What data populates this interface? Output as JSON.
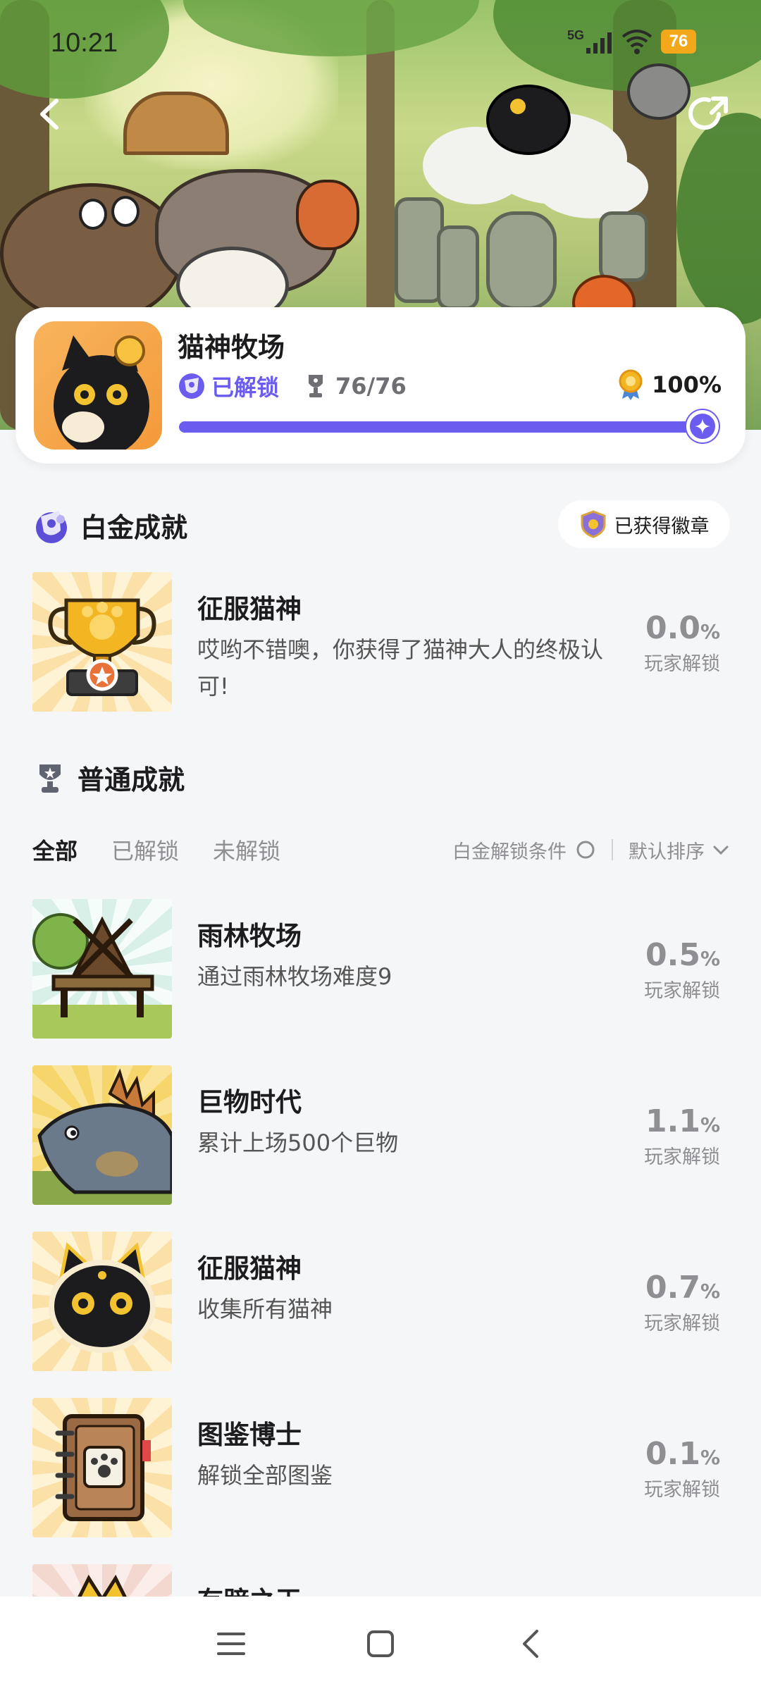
{
  "status_bar": {
    "time": "10:21",
    "network": "5G",
    "battery": "76"
  },
  "game": {
    "title": "猫神牧场",
    "unlock_label": "已解锁",
    "achievement_count": "76/76",
    "completion_percent": "100%",
    "completion_progress": 1.0,
    "accent_color": "#6b5cf0"
  },
  "platinum_section": {
    "title": "白金成就",
    "badge_button": "已获得徽章",
    "achievement": {
      "name": "征服猫神",
      "description": "哎哟不错噢，你获得了猫神大人的终极认可!",
      "percent_value": "0.0",
      "percent_sign": "%",
      "percent_label": "玩家解锁",
      "icon": "trophy-paw-icon"
    }
  },
  "normal_section": {
    "title": "普通成就",
    "tabs": [
      "全部",
      "已解锁",
      "未解锁"
    ],
    "platinum_condition": "白金解锁条件",
    "sort_label": "默认排序",
    "achievements": [
      {
        "name": "雨林牧场",
        "description": "通过雨林牧场难度9",
        "percent_value": "0.5",
        "percent_sign": "%",
        "percent_label": "玩家解锁",
        "icon": "windmill-icon"
      },
      {
        "name": "巨物时代",
        "description": "累计上场500个巨物",
        "percent_value": "1.1",
        "percent_sign": "%",
        "percent_label": "玩家解锁",
        "icon": "dinosaur-icon"
      },
      {
        "name": "征服猫神",
        "description": "收集所有猫神",
        "percent_value": "0.7",
        "percent_sign": "%",
        "percent_label": "玩家解锁",
        "icon": "black-cat-icon"
      },
      {
        "name": "图鉴博士",
        "description": "解锁全部图鉴",
        "percent_value": "0.1",
        "percent_sign": "%",
        "percent_label": "玩家解锁",
        "icon": "notebook-icon"
      },
      {
        "name": "有蹄之王",
        "icon": "crown-icon"
      }
    ]
  }
}
